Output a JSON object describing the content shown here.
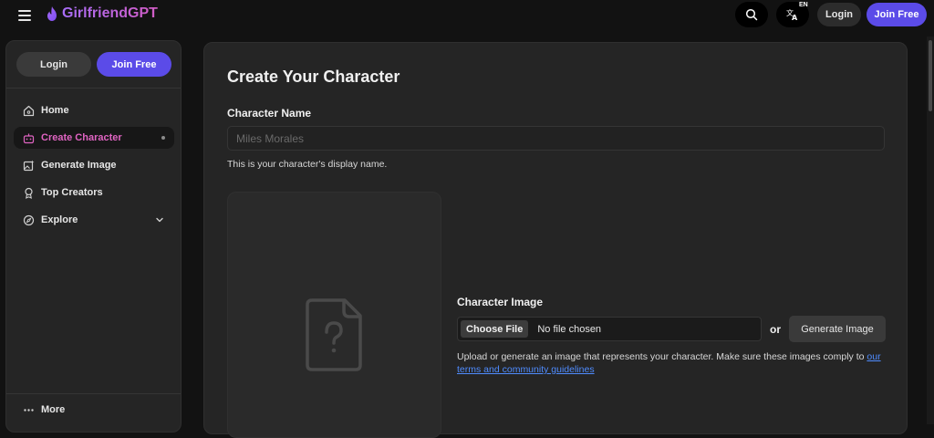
{
  "header": {
    "app_name": "GirlfriendGPT",
    "lang_code": "EN",
    "login_label": "Login",
    "join_label": "Join Free"
  },
  "sidebar": {
    "login_label": "Login",
    "join_label": "Join Free",
    "items": [
      {
        "label": "Home",
        "icon": "home-icon"
      },
      {
        "label": "Create Character",
        "icon": "robot-icon",
        "active": true
      },
      {
        "label": "Generate Image",
        "icon": "image-sparkle-icon"
      },
      {
        "label": "Top Creators",
        "icon": "award-icon"
      },
      {
        "label": "Explore",
        "icon": "compass-icon"
      }
    ],
    "more_label": "More"
  },
  "main": {
    "title": "Create Your Character",
    "name_label": "Character Name",
    "name_placeholder": "Miles Morales",
    "name_helper": "This is your character's display name.",
    "image_label": "Character Image",
    "choose_file_label": "Choose File",
    "no_file_text": "No file chosen",
    "or_text": "or",
    "generate_image_label": "Generate Image",
    "image_helper_prefix": "Upload or generate an image that represents your character. Make sure these images comply to ",
    "guidelines_link": "our terms and community guidelines"
  },
  "colors": {
    "accent": "#5b4be8",
    "active_nav": "#e064c2",
    "link": "#4f8cff"
  }
}
